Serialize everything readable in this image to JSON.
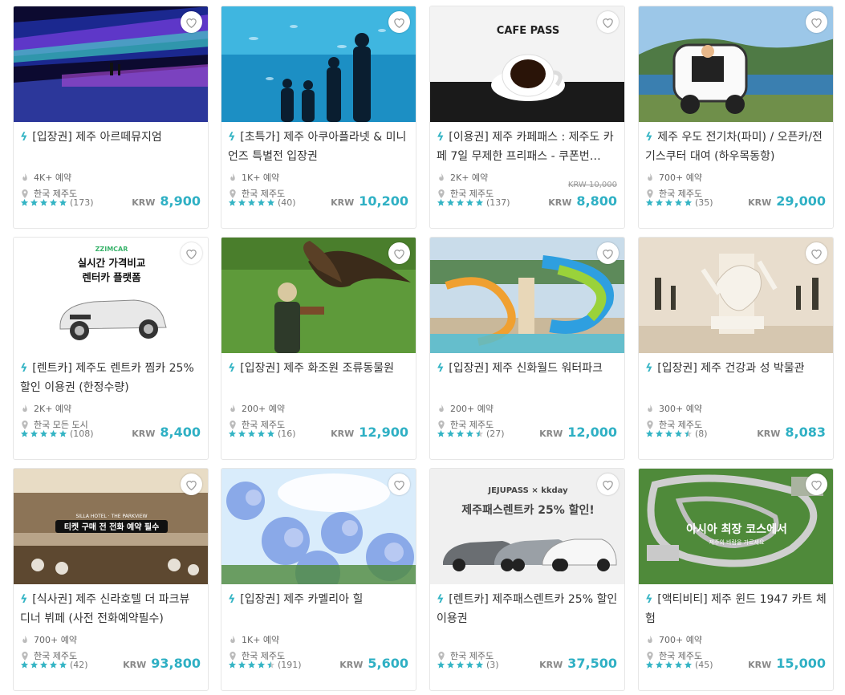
{
  "currency": "KRW",
  "colors": {
    "accent": "#2fb0c4",
    "star": "#34b4c4",
    "star_empty": "#cccccc"
  },
  "cards": [
    {
      "title": "[입장권] 제주 아르떼뮤지엄",
      "bookings": "4K+ 예약",
      "location": "한국 제주도",
      "rating": 5,
      "reviews": "(173)",
      "price": "8,900",
      "image": "art-museum-neon-lights"
    },
    {
      "title": "[초특가] 제주 아쿠아플라넷 & 미니언즈 특별전 입장권",
      "bookings": "1K+ 예약",
      "location": "한국 제주도",
      "rating": 5,
      "reviews": "(40)",
      "price": "10,200",
      "image": "aquarium-silhouettes"
    },
    {
      "title": "[이용권] 제주 카페패스 : 제주도 카페 7일 무제한 프리패스 - 쿠폰번…",
      "bookings": "2K+ 예약",
      "location": "한국 제주도",
      "rating": 5,
      "reviews": "(137)",
      "price": "8,800",
      "original_price": "KRW 10,000",
      "image": "cafe-pass-coffee-cup",
      "image_text": "CAFE PASS"
    },
    {
      "title": "제주 우도 전기차(파미) / 오픈카/전기스쿠터 대여 (하우목동항)",
      "bookings": "700+ 예약",
      "location": "한국 제주도",
      "rating": 5,
      "reviews": "(35)",
      "price": "29,000",
      "image": "electric-car-coast"
    },
    {
      "title": "[렌트카] 제주도 렌트카 찜카 25% 할인 이용권 (한정수량)",
      "bookings": "2K+ 예약",
      "location": "한국 모든 도시",
      "rating": 5,
      "reviews": "(108)",
      "price": "8,400",
      "image": "rental-convertible",
      "image_text": "실시간 가격비교 렌터카 플랫폼",
      "image_brand": "ZZIMCAR"
    },
    {
      "title": "[입장권] 제주 화조원 조류동물원",
      "bookings": "200+ 예약",
      "location": "한국 제주도",
      "rating": 5,
      "reviews": "(16)",
      "price": "12,900",
      "image": "falconry-eagle"
    },
    {
      "title": "[입장권] 제주 신화월드 워터파크",
      "bookings": "200+ 예약",
      "location": "한국 제주도",
      "rating": 4.5,
      "reviews": "(27)",
      "price": "12,000",
      "image": "water-park-slides"
    },
    {
      "title": "[입장권] 제주 건강과 성 박물관",
      "bookings": "300+ 예약",
      "location": "한국 제주도",
      "rating": 4.5,
      "reviews": "(8)",
      "price": "8,083",
      "image": "museum-sculpture"
    },
    {
      "title": "[식사권] 제주 신라호텔 더 파크뷰 디너 뷔페 (사전 전화예약필수)",
      "bookings": "700+ 예약",
      "location": "한국 제주도",
      "rating": 5,
      "reviews": "(42)",
      "price": "93,800",
      "image": "hotel-buffet",
      "image_text": "티켓 구매 전 전화 예약 필수",
      "image_brand": "SILLA HOTEL · THE PARKVIEW"
    },
    {
      "title": "[입장권] 제주 카멜리아 힐",
      "bookings": "1K+ 예약",
      "location": "한국 제주도",
      "rating": 4.5,
      "reviews": "(191)",
      "price": "5,600",
      "image": "hydrangea-flowers"
    },
    {
      "title": "[렌트카] 제주패스렌트카 25% 할인 이용권",
      "bookings": "",
      "location": "한국 제주도",
      "rating": 5,
      "reviews": "(3)",
      "price": "37,500",
      "image": "rental-cars-lineup",
      "image_text": "제주패스렌트카 25% 할인!",
      "image_brand": "JEJUPASS × kkday"
    },
    {
      "title": "[액티비티] 제주 윈드 1947 카트 체험",
      "bookings": "700+ 예약",
      "location": "한국 제주도",
      "rating": 5,
      "reviews": "(45)",
      "price": "15,000",
      "image": "kart-track-aerial",
      "image_text": "아시아 최장 코스에서",
      "image_subtext": "제주의 바람을 가르세요"
    }
  ]
}
